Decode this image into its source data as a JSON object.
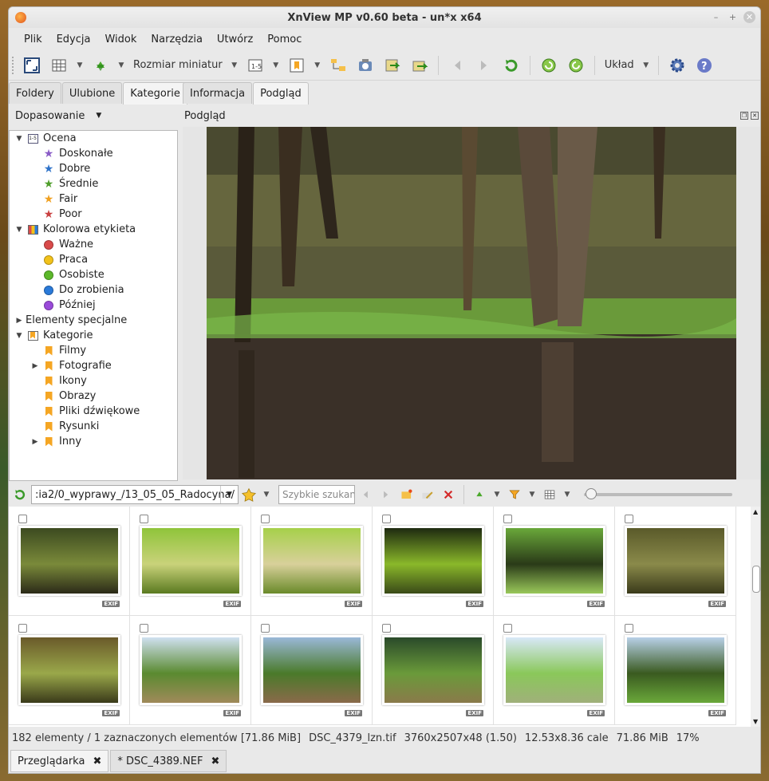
{
  "window": {
    "title": "XnView MP v0.60 beta - un*x x64"
  },
  "menu": [
    "Plik",
    "Edycja",
    "Widok",
    "Narzędzia",
    "Utwórz",
    "Pomoc"
  ],
  "toolbar": {
    "thumb_size_label": "Rozmiar miniatur",
    "layout_label": "Układ"
  },
  "left_tabs": [
    "Foldery",
    "Ulubione",
    "Kategorie"
  ],
  "right_tabs": [
    "Informacja",
    "Podgląd"
  ],
  "filter_label": "Dopasowanie",
  "preview_label": "Podgląd",
  "tree": [
    {
      "label": "Ocena",
      "level": 0,
      "expanded": true,
      "icon": "rating-icon"
    },
    {
      "label": "Doskonałe",
      "level": 1,
      "icon": "star",
      "color": "#8a5cc7"
    },
    {
      "label": "Dobre",
      "level": 1,
      "icon": "star",
      "color": "#2f73c9"
    },
    {
      "label": "Średnie",
      "level": 1,
      "icon": "star",
      "color": "#4f9e2b"
    },
    {
      "label": "Fair",
      "level": 1,
      "icon": "star",
      "color": "#f0a020"
    },
    {
      "label": "Poor",
      "level": 1,
      "icon": "star",
      "color": "#c94040"
    },
    {
      "label": "Kolorowa etykieta",
      "level": 0,
      "expanded": true,
      "icon": "palette-icon"
    },
    {
      "label": "Ważne",
      "level": 1,
      "icon": "dot",
      "color": "#d94a4a"
    },
    {
      "label": "Praca",
      "level": 1,
      "icon": "dot",
      "color": "#f2c21a"
    },
    {
      "label": "Osobiste",
      "level": 1,
      "icon": "dot",
      "color": "#5cb82a"
    },
    {
      "label": "Do zrobienia",
      "level": 1,
      "icon": "dot",
      "color": "#2a7ad9"
    },
    {
      "label": "Później",
      "level": 1,
      "icon": "dot",
      "color": "#9a4ad9"
    },
    {
      "label": "Elementy specjalne",
      "level": 0,
      "expanded": false,
      "icon": "none"
    },
    {
      "label": "Kategorie",
      "level": 0,
      "expanded": true,
      "icon": "category-icon"
    },
    {
      "label": "Filmy",
      "level": 1,
      "icon": "bookmark"
    },
    {
      "label": "Fotografie",
      "level": 1,
      "icon": "bookmark",
      "collapsed": true
    },
    {
      "label": "Ikony",
      "level": 1,
      "icon": "bookmark"
    },
    {
      "label": "Obrazy",
      "level": 1,
      "icon": "bookmark"
    },
    {
      "label": "Pliki dźwiękowe",
      "level": 1,
      "icon": "bookmark"
    },
    {
      "label": "Rysunki",
      "level": 1,
      "icon": "bookmark"
    },
    {
      "label": "Inny",
      "level": 1,
      "icon": "bookmark",
      "collapsed": true
    }
  ],
  "path": ":ia2/0_wyprawy_/13_05_05_Radocyna/",
  "search_placeholder": "Szybkie szukan",
  "thumbnails": [
    {
      "exif": "EXIF",
      "palette": [
        "#3c4a20",
        "#7a8a3a",
        "#2b2a18"
      ]
    },
    {
      "exif": "EXIF",
      "palette": [
        "#8fc43a",
        "#c9d27a",
        "#5a7a20"
      ]
    },
    {
      "exif": "EXIF",
      "palette": [
        "#a6d04a",
        "#d8d09a",
        "#6a8a2a"
      ]
    },
    {
      "exif": "EXIF",
      "palette": [
        "#1e2a10",
        "#8ab82a",
        "#3a4a18"
      ]
    },
    {
      "exif": "EXIF",
      "palette": [
        "#6aa83a",
        "#2a3a18",
        "#9ac85a"
      ]
    },
    {
      "exif": "EXIF",
      "palette": [
        "#5a5a2a",
        "#8a8a4a",
        "#3a3a1a"
      ]
    },
    {
      "exif": "EXIF",
      "palette": [
        "#6a5a2a",
        "#9aa84a",
        "#3a3a1a"
      ]
    },
    {
      "exif": "EXIF",
      "palette": [
        "#cfe0f0",
        "#5a8a30",
        "#a08a5a"
      ]
    },
    {
      "exif": "EXIF",
      "palette": [
        "#9ab8d8",
        "#4a7a2a",
        "#8a6a4a"
      ]
    },
    {
      "exif": "EXIF",
      "palette": [
        "#2a4a2a",
        "#6a9a3a",
        "#8a7a4a"
      ]
    },
    {
      "exif": "EXIF",
      "palette": [
        "#d8e8f8",
        "#8ac85a",
        "#a0b07a"
      ]
    },
    {
      "exif": "EXIF",
      "palette": [
        "#b8d0e8",
        "#3a5a20",
        "#6aa83a"
      ]
    }
  ],
  "status": {
    "count": "182 elementy / 1 zaznaczonych elementów [71.86 MiB]",
    "file": "DSC_4379_lzn.tif",
    "dims": "3760x2507x48 (1.50)",
    "print": "12.53x8.36 cale",
    "size": "71.86 MiB",
    "zoom": "17%"
  },
  "bottom_tabs": [
    {
      "label": "Przeglądarka",
      "active": true
    },
    {
      "label": "* DSC_4389.NEF",
      "active": false
    }
  ]
}
